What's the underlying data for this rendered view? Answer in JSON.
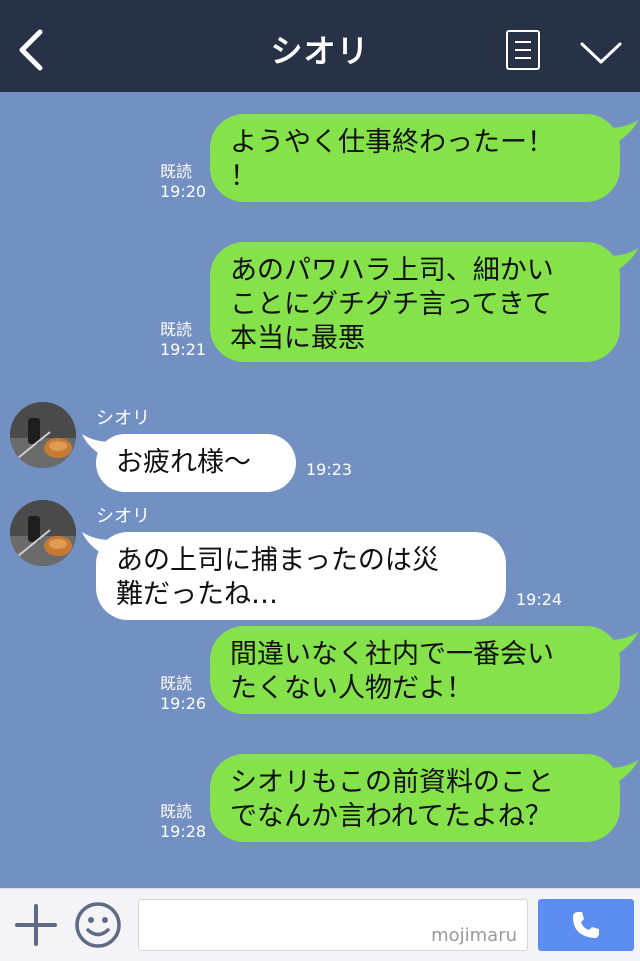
{
  "header": {
    "title": "シオリ",
    "back_icon": "chevron-left-icon",
    "menu_icon": "menu-list-icon",
    "collapse_icon": "chevron-down-icon"
  },
  "messages": [
    {
      "from": "me",
      "lines": [
        "ようやく仕事終わったー！",
        "！"
      ],
      "read": "既読",
      "time": "19:20"
    },
    {
      "from": "me",
      "lines": [
        "あのパワハラ上司、細かい",
        "ことにグチグチ言ってきて",
        "本当に最悪"
      ],
      "read": "既読",
      "time": "19:21"
    },
    {
      "from": "them",
      "sender": "シオリ",
      "lines": [
        "お疲れ様〜"
      ],
      "time": "19:23"
    },
    {
      "from": "them",
      "sender": "シオリ",
      "lines": [
        "あの上司に捕まったのは災",
        "難だったね…"
      ],
      "time": "19:24"
    },
    {
      "from": "me",
      "lines": [
        "間違いなく社内で一番会い",
        "たくない人物だよ！"
      ],
      "read": "既読",
      "time": "19:26"
    },
    {
      "from": "me",
      "lines": [
        "シオリもこの前資料のこと",
        "でなんか言われてたよね？"
      ],
      "read": "既読",
      "time": "19:28"
    }
  ],
  "footer": {
    "plus_icon": "plus-icon",
    "emoji_icon": "smiley-icon",
    "watermark": "mojimaru",
    "call_icon": "phone-icon"
  },
  "colors": {
    "header_bg": "#273247",
    "chat_bg": "#7390c2",
    "my_bubble": "#86e24a",
    "their_bubble": "#ffffff",
    "call_button": "#5b8ef0"
  }
}
